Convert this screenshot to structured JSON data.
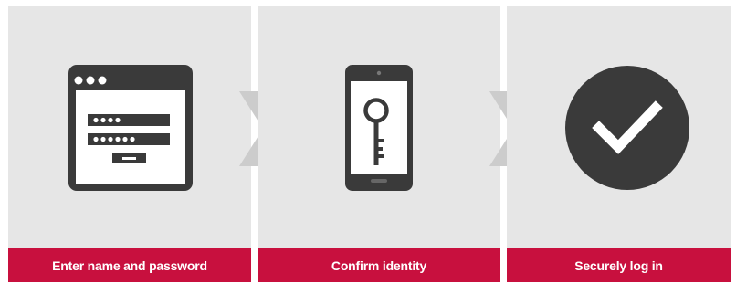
{
  "steps": [
    {
      "label": "Enter name and password",
      "icon": "login-window-icon"
    },
    {
      "label": "Confirm identity",
      "icon": "phone-key-icon"
    },
    {
      "label": "Securely log in",
      "icon": "checkmark-circle-icon"
    }
  ],
  "colors": {
    "panel_background": "#e6e6e6",
    "caption_background": "#c8103e",
    "caption_text": "#ffffff",
    "icon": "#3a3a3a",
    "arrow": "#cccccc"
  }
}
